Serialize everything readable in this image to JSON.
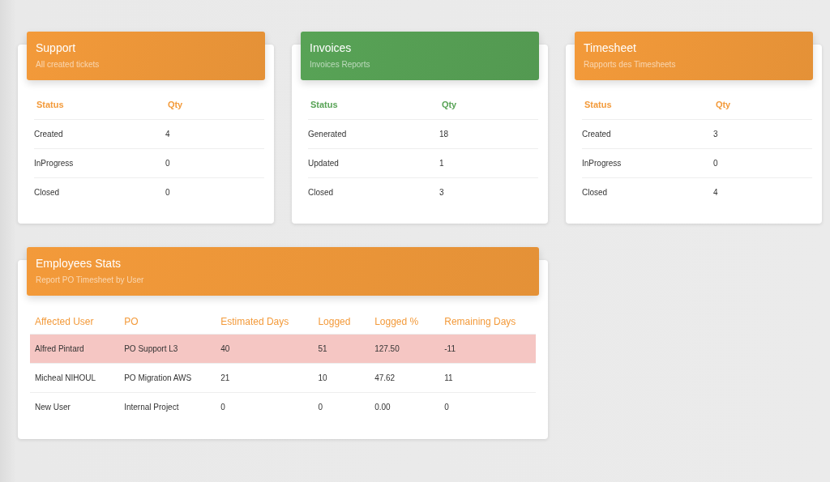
{
  "status_cards": [
    {
      "title": "Support",
      "subtitle": "All created tickets",
      "color": "#f39a3a",
      "columns": [
        "Status",
        "Qty"
      ],
      "rows": [
        [
          "Created",
          "4"
        ],
        [
          "InProgress",
          "0"
        ],
        [
          "Closed",
          "0"
        ]
      ]
    },
    {
      "title": "Invoices",
      "subtitle": "Invoices Reports",
      "color": "#58a356",
      "columns": [
        "Status",
        "Qty"
      ],
      "rows": [
        [
          "Generated",
          "18"
        ],
        [
          "Updated",
          "1"
        ],
        [
          "Closed",
          "3"
        ]
      ]
    },
    {
      "title": "Timesheet",
      "subtitle": "Rapports des Timesheets",
      "color": "#f39a3a",
      "columns": [
        "Status",
        "Qty"
      ],
      "rows": [
        [
          "Created",
          "3"
        ],
        [
          "InProgress",
          "0"
        ],
        [
          "Closed",
          "4"
        ]
      ]
    }
  ],
  "employees_stats": {
    "title": "Employees Stats",
    "subtitle": "Report PO Timesheet by User",
    "color": "#f39a3a",
    "columns": [
      "Affected User",
      "PO",
      "Estimated Days",
      "Logged",
      "Logged %",
      "Remaining Days"
    ],
    "rows": [
      {
        "cells": [
          "Alfred Pintard",
          "PO Support L3",
          "40",
          "51",
          "127.50",
          "-11"
        ],
        "highlighted": true
      },
      {
        "cells": [
          "Micheal NIHOUL",
          "PO Migration AWS",
          "21",
          "10",
          "47.62",
          "11"
        ],
        "highlighted": false
      },
      {
        "cells": [
          "New User",
          "Internal Project",
          "0",
          "0",
          "0.00",
          "0"
        ],
        "highlighted": false
      }
    ]
  }
}
